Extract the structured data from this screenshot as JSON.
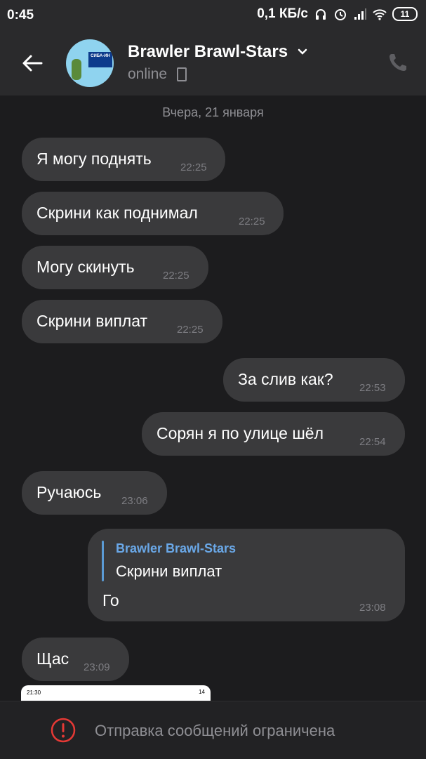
{
  "status": {
    "time": "0:45",
    "speed": "0,1 КБ/с",
    "battery": "11"
  },
  "header": {
    "title": "Brawler Brawl-Stars",
    "subtitle": "online",
    "avatar_sign_text": "СИБА-ИН"
  },
  "date_separator": "Вчера, 21 января",
  "messages": [
    {
      "side": "in",
      "text": "Я могу поднять",
      "time": "22:25"
    },
    {
      "side": "in",
      "text": "Скрини как поднимал",
      "time": "22:25"
    },
    {
      "side": "in",
      "text": "Могу скинуть",
      "time": "22:25"
    },
    {
      "side": "in",
      "text": "Скрини виплат",
      "time": "22:25"
    },
    {
      "side": "out",
      "text": "За слив как?",
      "time": "22:53"
    },
    {
      "side": "out",
      "text": "Сорян я по улице шёл",
      "time": "22:54"
    },
    {
      "side": "in",
      "text": "Ручаюсь",
      "time": "23:06"
    },
    {
      "side": "out",
      "text": "Го",
      "time": "23:08",
      "reply": {
        "name": "Brawler Brawl-Stars",
        "text": "Скрини виплат"
      }
    },
    {
      "side": "in",
      "text": "Щас",
      "time": "23:09"
    }
  ],
  "peek": {
    "time": "21:30",
    "battery": "14"
  },
  "footer": {
    "message": "Отправка сообщений ограничена"
  },
  "colors": {
    "background": "#1c1c1e",
    "bar": "#2a2a2c",
    "bubble": "#3a3a3c",
    "reply_accent": "#5b9bd5",
    "warning": "#e53935"
  }
}
